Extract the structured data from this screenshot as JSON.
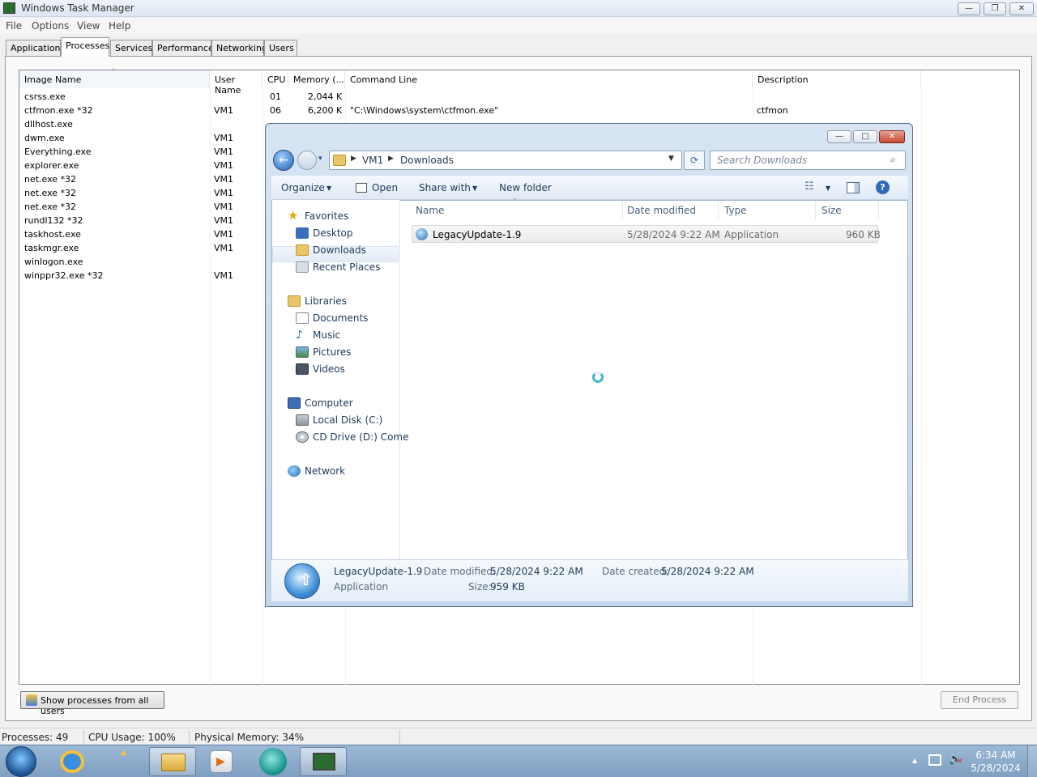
{
  "task_manager": {
    "title": "Windows Task Manager",
    "menu": [
      "File",
      "Options",
      "View",
      "Help"
    ],
    "tabs": [
      "Applications",
      "Processes",
      "Services",
      "Performance",
      "Networking",
      "Users"
    ],
    "active_tab": "Processes",
    "columns": {
      "image_name": "Image Name",
      "user_name": "User Name",
      "cpu": "CPU",
      "memory": "Memory (...",
      "command_line": "Command Line",
      "description": "Description"
    },
    "processes": [
      {
        "name": "csrss.exe",
        "user": "",
        "cpu": "01",
        "mem": "2,044 K",
        "cmd": "",
        "desc": ""
      },
      {
        "name": "ctfmon.exe *32",
        "user": "VM1",
        "cpu": "06",
        "mem": "6,200 K",
        "cmd": "\"C:\\Windows\\system\\ctfmon.exe\"",
        "desc": "ctfmon"
      },
      {
        "name": "dllhost.exe",
        "user": "",
        "cpu": "",
        "mem": "",
        "cmd": "",
        "desc": ""
      },
      {
        "name": "dwm.exe",
        "user": "VM1",
        "cpu": "",
        "mem": "",
        "cmd": "",
        "desc": ""
      },
      {
        "name": "Everything.exe",
        "user": "VM1",
        "cpu": "",
        "mem": "",
        "cmd": "",
        "desc": ""
      },
      {
        "name": "explorer.exe",
        "user": "VM1",
        "cpu": "",
        "mem": "",
        "cmd": "",
        "desc": ""
      },
      {
        "name": "net.exe *32",
        "user": "VM1",
        "cpu": "",
        "mem": "",
        "cmd": "",
        "desc": ""
      },
      {
        "name": "net.exe *32",
        "user": "VM1",
        "cpu": "",
        "mem": "",
        "cmd": "",
        "desc": ""
      },
      {
        "name": "net.exe *32",
        "user": "VM1",
        "cpu": "",
        "mem": "",
        "cmd": "",
        "desc": ""
      },
      {
        "name": "rundl132 *32",
        "user": "VM1",
        "cpu": "",
        "mem": "",
        "cmd": "",
        "desc": ""
      },
      {
        "name": "taskhost.exe",
        "user": "VM1",
        "cpu": "",
        "mem": "",
        "cmd": "",
        "desc": ""
      },
      {
        "name": "taskmgr.exe",
        "user": "VM1",
        "cpu": "",
        "mem": "",
        "cmd": "",
        "desc": ""
      },
      {
        "name": "winlogon.exe",
        "user": "",
        "cpu": "",
        "mem": "",
        "cmd": "",
        "desc": ""
      },
      {
        "name": "winppr32.exe *32",
        "user": "VM1",
        "cpu": "",
        "mem": "",
        "cmd": "",
        "desc": ""
      }
    ],
    "show_all_button": "Show processes from all users",
    "end_process_button": "End Process",
    "status": {
      "processes": "Processes: 49",
      "cpu": "CPU Usage: 100%",
      "memory": "Physical Memory: 34%"
    }
  },
  "explorer": {
    "breadcrumb": [
      "VM1",
      "Downloads"
    ],
    "search_placeholder": "Search Downloads",
    "toolbar": {
      "organize": "Organize",
      "open": "Open",
      "share_with": "Share with",
      "new_folder": "New folder"
    },
    "nav": {
      "favorites": "Favorites",
      "favorites_items": [
        "Desktop",
        "Downloads",
        "Recent Places"
      ],
      "libraries": "Libraries",
      "libraries_items": [
        "Documents",
        "Music",
        "Pictures",
        "Videos"
      ],
      "computer": "Computer",
      "computer_items": [
        "Local Disk (C:)",
        "CD Drive (D:) Come"
      ],
      "network": "Network"
    },
    "columns": {
      "name": "Name",
      "date": "Date modified",
      "type": "Type",
      "size": "Size"
    },
    "files": [
      {
        "name": "LegacyUpdate-1.9",
        "date": "5/28/2024 9:22 AM",
        "type": "Application",
        "size": "960 KB"
      }
    ],
    "details": {
      "name": "LegacyUpdate-1.9",
      "type": "Application",
      "date_modified_label": "Date modified:",
      "date_modified": "5/28/2024 9:22 AM",
      "size_label": "Size:",
      "size": "959 KB",
      "date_created_label": "Date created:",
      "date_created": "5/28/2024 9:22 AM"
    }
  },
  "taskbar": {
    "time": "6:34 AM",
    "date": "5/28/2024"
  },
  "colors": {
    "explorer_frame": "#c3d5ea",
    "taskbar": "#8aa8c8",
    "nav_text": "#1e395b"
  }
}
